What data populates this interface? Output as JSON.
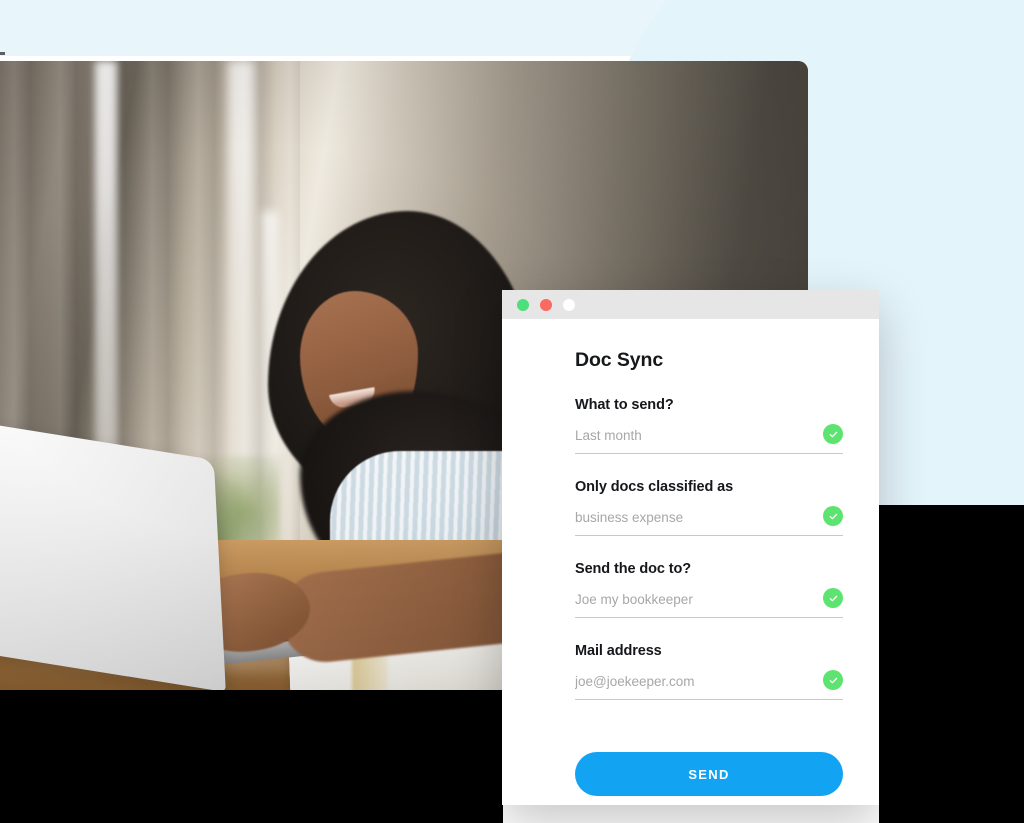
{
  "background": {
    "page_color": "#ffffff",
    "accent_wash_color": "#e4f4fb",
    "plate_color": "#000000"
  },
  "photo": {
    "alt": "Woman with curly hair smiling while typing on a white laptop at a wooden desk beside an open notebook, soft daylight through curtains",
    "name": "hero-photo"
  },
  "window": {
    "traffic_lights": [
      {
        "name": "close-dot",
        "color": "#4cdf7c"
      },
      {
        "name": "minimize-dot",
        "color": "#fb6a61"
      },
      {
        "name": "maximize-dot",
        "color": "#ffffff"
      }
    ],
    "titlebar_color": "#e6e6e6"
  },
  "app": {
    "title": "Doc Sync",
    "fields": [
      {
        "label": "What to send?",
        "value": "",
        "placeholder": "Last month",
        "validated": true
      },
      {
        "label": "Only docs classified as",
        "value": "",
        "placeholder": "business expense",
        "validated": true
      },
      {
        "label": "Send the doc to?",
        "value": "",
        "placeholder": "Joe my bookkeeper",
        "validated": true
      },
      {
        "label": "Mail address",
        "value": "",
        "placeholder": "joe@joekeeper.com",
        "validated": true
      }
    ],
    "submit": {
      "label": "SEND",
      "color": "#13a3f3",
      "text_color": "#ffffff"
    },
    "validation_badge": {
      "icon": "check-icon",
      "color": "#5de36f"
    }
  }
}
